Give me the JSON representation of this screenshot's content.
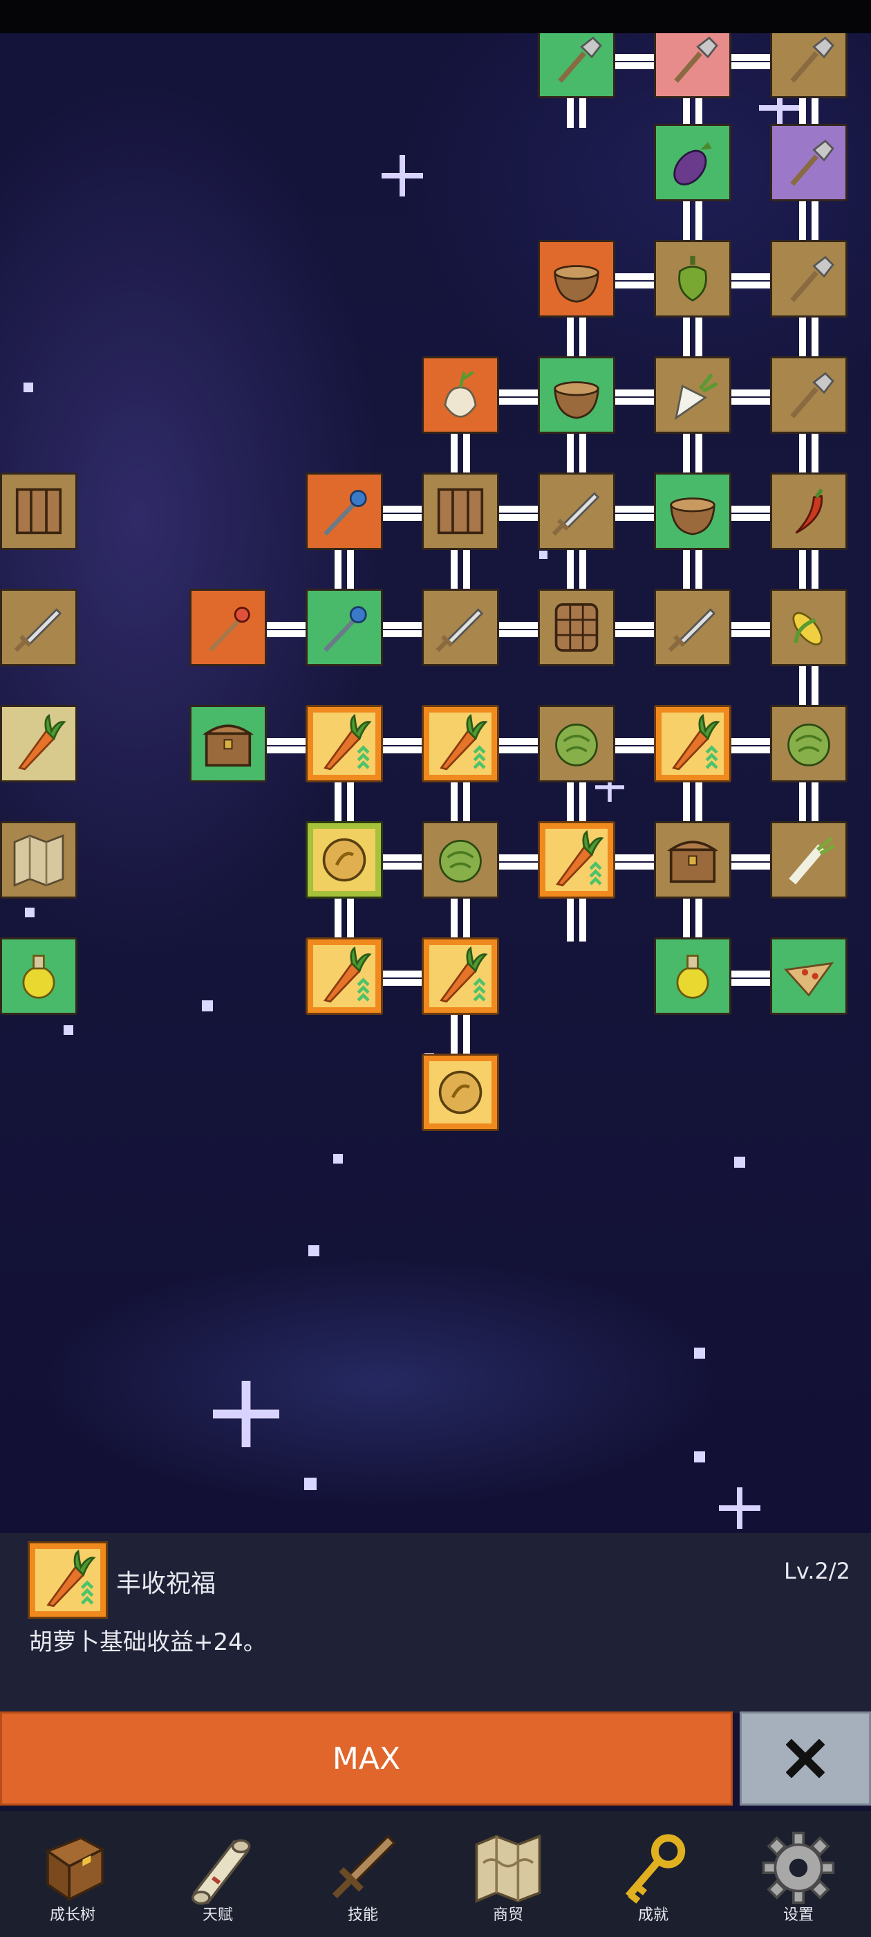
{
  "skill_tree": {
    "nodes": [
      {
        "id": "n1",
        "icon": "shovel-icon",
        "bg": "green"
      },
      {
        "id": "n2",
        "icon": "shovel-icon",
        "bg": "pink"
      },
      {
        "id": "n3",
        "icon": "shovel-icon",
        "bg": "tan"
      },
      {
        "id": "n4",
        "icon": "eggplant-icon",
        "bg": "green"
      },
      {
        "id": "n5",
        "icon": "shovel-icon",
        "bg": "purple"
      },
      {
        "id": "n6",
        "icon": "bowl-icon",
        "bg": "orange"
      },
      {
        "id": "n7",
        "icon": "pepper-icon",
        "bg": "tan"
      },
      {
        "id": "n8",
        "icon": "shovel-icon",
        "bg": "tan"
      },
      {
        "id": "n9",
        "icon": "garlic-icon",
        "bg": "orange"
      },
      {
        "id": "n10",
        "icon": "bowl-icon",
        "bg": "green"
      },
      {
        "id": "n11",
        "icon": "radish-icon",
        "bg": "tan"
      },
      {
        "id": "n12",
        "icon": "shovel-icon",
        "bg": "tan"
      },
      {
        "id": "n13",
        "icon": "wand-icon",
        "bg": "orange"
      },
      {
        "id": "n14",
        "icon": "crate-icon",
        "bg": "tan"
      },
      {
        "id": "n15",
        "icon": "sword-icon",
        "bg": "tan"
      },
      {
        "id": "n16",
        "icon": "bowl-icon",
        "bg": "green"
      },
      {
        "id": "n17",
        "icon": "chili-icon",
        "bg": "tan"
      },
      {
        "id": "n18",
        "icon": "crate-icon",
        "bg": "tan"
      },
      {
        "id": "n19",
        "icon": "staff-icon",
        "bg": "orange"
      },
      {
        "id": "n20",
        "icon": "wand-icon",
        "bg": "green"
      },
      {
        "id": "n21",
        "icon": "sword-icon",
        "bg": "tan"
      },
      {
        "id": "n22",
        "icon": "barrel-icon",
        "bg": "tan"
      },
      {
        "id": "n23",
        "icon": "sword-icon",
        "bg": "tan"
      },
      {
        "id": "n24",
        "icon": "corn-icon",
        "bg": "tan"
      },
      {
        "id": "n25",
        "icon": "sword-icon",
        "bg": "tan"
      },
      {
        "id": "n26",
        "icon": "chest-icon",
        "bg": "green"
      },
      {
        "id": "n27",
        "icon": "carrot-icon",
        "bg": "gold"
      },
      {
        "id": "n28",
        "icon": "carrot-icon",
        "bg": "gold"
      },
      {
        "id": "n29",
        "icon": "cabbage-icon",
        "bg": "tan"
      },
      {
        "id": "n30",
        "icon": "carrot-icon",
        "bg": "gold"
      },
      {
        "id": "n31",
        "icon": "cabbage-icon",
        "bg": "tan"
      },
      {
        "id": "n32",
        "icon": "carrot-icon",
        "bg": "lighttan"
      },
      {
        "id": "n33",
        "icon": "coin-icon",
        "bg": "goldgreen"
      },
      {
        "id": "n34",
        "icon": "cabbage-icon",
        "bg": "tan"
      },
      {
        "id": "n35",
        "icon": "carrot-icon",
        "bg": "gold"
      },
      {
        "id": "n36",
        "icon": "chest-icon",
        "bg": "tan"
      },
      {
        "id": "n37",
        "icon": "leek-icon",
        "bg": "tan"
      },
      {
        "id": "n38",
        "icon": "map-icon",
        "bg": "tan"
      },
      {
        "id": "n39",
        "icon": "carrot-icon",
        "bg": "gold"
      },
      {
        "id": "n40",
        "icon": "carrot-icon",
        "bg": "gold"
      },
      {
        "id": "n41",
        "icon": "potion-icon",
        "bg": "green"
      },
      {
        "id": "n42",
        "icon": "pizza-icon",
        "bg": "green"
      },
      {
        "id": "n43",
        "icon": "potion-icon",
        "bg": "green"
      },
      {
        "id": "n44",
        "icon": "coin-icon",
        "bg": "gold"
      }
    ]
  },
  "detail_panel": {
    "icon": "carrot-icon",
    "name": "丰收祝福",
    "level": "Lv.2/2",
    "description": "胡萝卜基础收益+24。"
  },
  "actions": {
    "max_label": "MAX",
    "close_icon": "close-icon"
  },
  "nav": {
    "items": [
      {
        "label": "成长树",
        "icon": "book-icon"
      },
      {
        "label": "天赋",
        "icon": "scroll-icon"
      },
      {
        "label": "技能",
        "icon": "sword-icon"
      },
      {
        "label": "商贸",
        "icon": "map-icon"
      },
      {
        "label": "成就",
        "icon": "key-icon"
      },
      {
        "label": "设置",
        "icon": "gear-icon"
      }
    ]
  },
  "colors": {
    "max_button": "#e0662c",
    "close_button": "#a6b0bc",
    "panel_bg": "#1f2236",
    "nav_bg": "#1c1f2e"
  }
}
